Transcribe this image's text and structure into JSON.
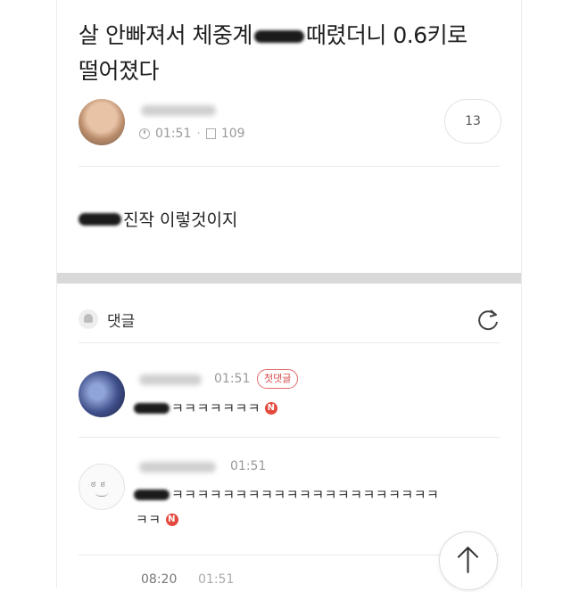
{
  "post": {
    "title_part1": "살 안빠져서 체중계",
    "title_part2": "때렸더니 0.6키로",
    "title_line2": "떨어졌다",
    "time": "01:51",
    "views": "109",
    "comment_count": "13",
    "body_text": "진작 이렇것이지"
  },
  "comments_header": {
    "label": "댓글"
  },
  "comments": [
    {
      "time": "01:51",
      "badge": "첫댓글",
      "text": "ㅋㅋㅋㅋㅋㅋㅋ",
      "new_badge": "N"
    },
    {
      "time": "01:51",
      "face": "ಠ ಠ",
      "text_line1": "ㅋㅋㅋㅋㅋㅋㅋㅋㅋㅋㅋㅋㅋㅋㅋㅋㅋㅋㅋㅋㅋ",
      "text_line2": "ㅋㅋ",
      "new_badge": "N"
    },
    {
      "time_a": "08:20",
      "time_b": "01:51"
    }
  ],
  "icons": {
    "clock": "clock-icon",
    "views": "document-icon",
    "bell": "bell-icon",
    "refresh": "refresh-icon",
    "scroll_top": "arrow-up-icon"
  },
  "colors": {
    "accent_red": "#e5493e",
    "divider_band": "#d9d9d9"
  }
}
